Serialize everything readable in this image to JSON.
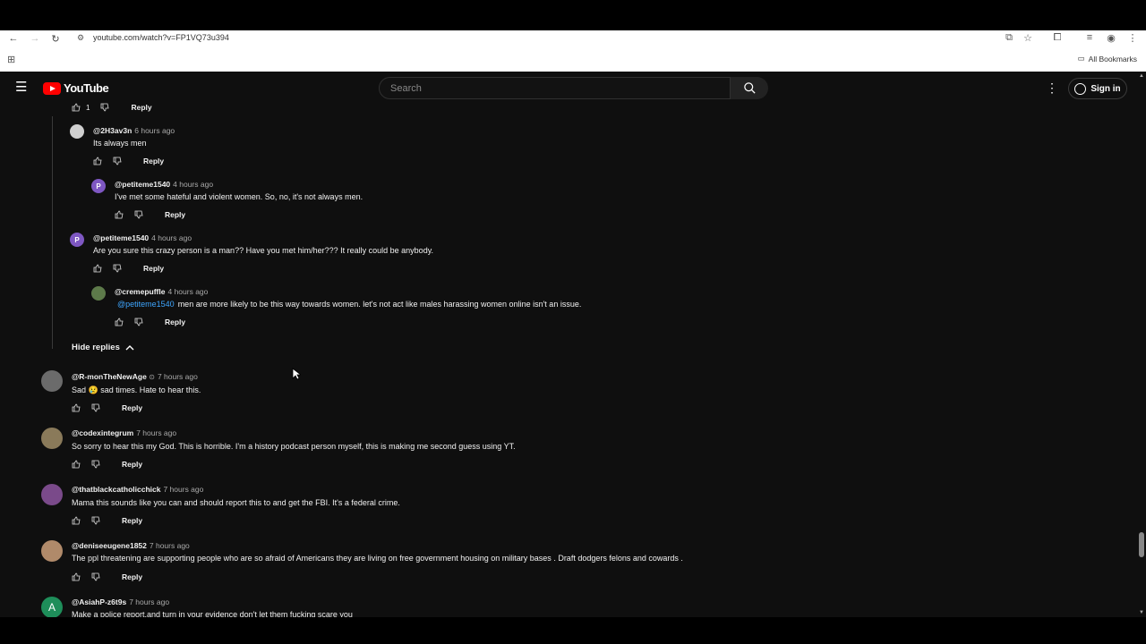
{
  "browser": {
    "url": "youtube.com/watch?v=FP1VQ73u394",
    "bookmarks_label": "All Bookmarks"
  },
  "masthead": {
    "logo_text": "YouTube",
    "search_placeholder": "Search",
    "sign_in_label": "Sign in"
  },
  "colors": {
    "bg": "#0f0f0f",
    "logo_red": "#ff0000",
    "mention": "#3ea6ff"
  },
  "top_action_row": {
    "likes": "1",
    "reply_label": "Reply"
  },
  "replies": [
    {
      "handle": "@2H3av3n",
      "time": "6 hours ago",
      "text": "Its always men",
      "avatar_letter": "",
      "avatar_color": "#cfcfcf",
      "reply_label": "Reply"
    },
    {
      "handle": "@petiteme1540",
      "time": "4 hours ago",
      "text": "I've met some hateful and violent women.  So, no, it's not always men.",
      "avatar_letter": "P",
      "avatar_color": "#7e57c2",
      "reply_label": "Reply"
    },
    {
      "handle": "@petiteme1540",
      "time": "4 hours ago",
      "text": "Are you sure this crazy person is a man??  Have you met him/her???  It really could be anybody.",
      "avatar_letter": "P",
      "avatar_color": "#7e57c2",
      "reply_label": "Reply"
    },
    {
      "handle": "@cremepuffle",
      "time": "4 hours ago",
      "mention": "@petiteme1540",
      "text": "men are more likely to be this way towards women. let's not act like males harassing women online isn't an issue.",
      "avatar_letter": "",
      "avatar_color": "#5d7a4a",
      "reply_label": "Reply"
    }
  ],
  "hide_replies_label": "Hide replies",
  "comments": [
    {
      "handle": "@R-monTheNewAge",
      "verified": true,
      "time": "7 hours ago",
      "text_before": "Sad",
      "emoji": "😢",
      "text_after": "sad times. Hate to hear this.",
      "avatar_color": "#6b6b6b",
      "reply_label": "Reply"
    },
    {
      "handle": "@codexintegrum",
      "time": "7 hours ago",
      "text": "So sorry to hear this my God. This is horrible. I'm a history podcast person myself, this is making me second guess using YT.",
      "avatar_color": "#8a7a5a",
      "reply_label": "Reply"
    },
    {
      "handle": "@thatblackcatholicchick",
      "time": "7 hours ago",
      "text": "Mama this sounds like you can and should report this to and get the FBI. It's a federal crime.",
      "avatar_color": "#7a4a8a",
      "reply_label": "Reply"
    },
    {
      "handle": "@deniseeugene1852",
      "time": "7 hours ago",
      "text": "The ppl threatening are supporting people who are so afraid of Americans they are living on free government housing on military bases . Draft dodgers felons and cowards .",
      "avatar_color": "#b08a6a",
      "reply_label": "Reply"
    },
    {
      "handle": "@AsiahP-z6t9s",
      "time": "7 hours ago",
      "text": "Make a police report,and turn in your evidence don't let them fucking scare you",
      "avatar_letter": "A",
      "avatar_color": "#1e8e5a",
      "reply_label": "Reply"
    }
  ]
}
